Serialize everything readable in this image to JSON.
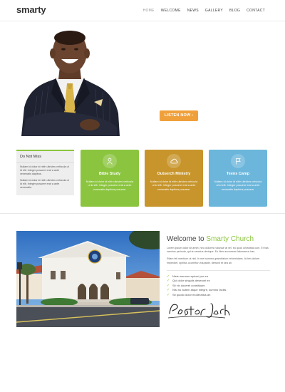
{
  "header": {
    "logo": "smarty",
    "nav": [
      "HOME",
      "WELCOME",
      "NEWS",
      "GALLERY",
      "BLOG",
      "CONTACT"
    ]
  },
  "hero": {
    "cta_label": "LISTEN NOW  ›",
    "slide_count": 3,
    "active_slide": 1
  },
  "notice": {
    "title": "Do Not Miss",
    "text_1": "Nullam id dolor id nibh ultricies vehicula ut id elit. Integer posuere erat a ante venenatis dapibus.",
    "text_2": "Nullam id dolor id nibh ultricies vehicula ut id elit. Integer posuere erat a ante venenatis."
  },
  "cards": [
    {
      "title": "Bible Study",
      "text": "Nullam id dolor id nibh ultricies vehicula ut id elit. Integer posuere erat a ante venenatis dapibus posuere.",
      "icon": "person-icon",
      "color": "#8bc53f"
    },
    {
      "title": "Outserch Ministry",
      "text": "Nullam id dolor id nibh ultricies vehicula ut id elit. Integer posuere erat a ante venenatis dapibus posuere.",
      "icon": "cloud-icon",
      "color": "#c7952b"
    },
    {
      "title": "Teens Camp",
      "text": "Nullam id dolor id nibh ultricies vehicula ut id elit. Integer posuere erat a ante venenatis dapibus posuere.",
      "icon": "flag-icon",
      "color": "#6cb6db"
    }
  ],
  "welcome": {
    "title_prefix": "Welcome to ",
    "title_highlight": "Smarty Church",
    "para_1": "Lorem ipsum dolor sit amet, hinc dolores noluisse at vel, eu quod urbanitas cum. Et has sanctus pericula, qui te sanctus denique. Eu liber accumsan laboramus has.",
    "para_2": "Etiam fell mentium ut nisi. In mei summo graecifalum reformidans. At hes dolore imperdiet, spiritus ocurretur voluptate, detraxit et sea an.",
    "bullets": [
      "Nisis memore epicuri pro ea",
      "Qui dolor singulis deserunt ex",
      "Sit vix doceret constituam",
      "Nisi no autem atque integre, summo facilis",
      "Sit quodo dolor moderatius an"
    ],
    "signature": "Pastor Jack"
  },
  "colors": {
    "accent_green": "#8bc53f",
    "cta_orange": "#f0a03b",
    "card_gold": "#c7952b",
    "card_blue": "#6cb6db"
  }
}
